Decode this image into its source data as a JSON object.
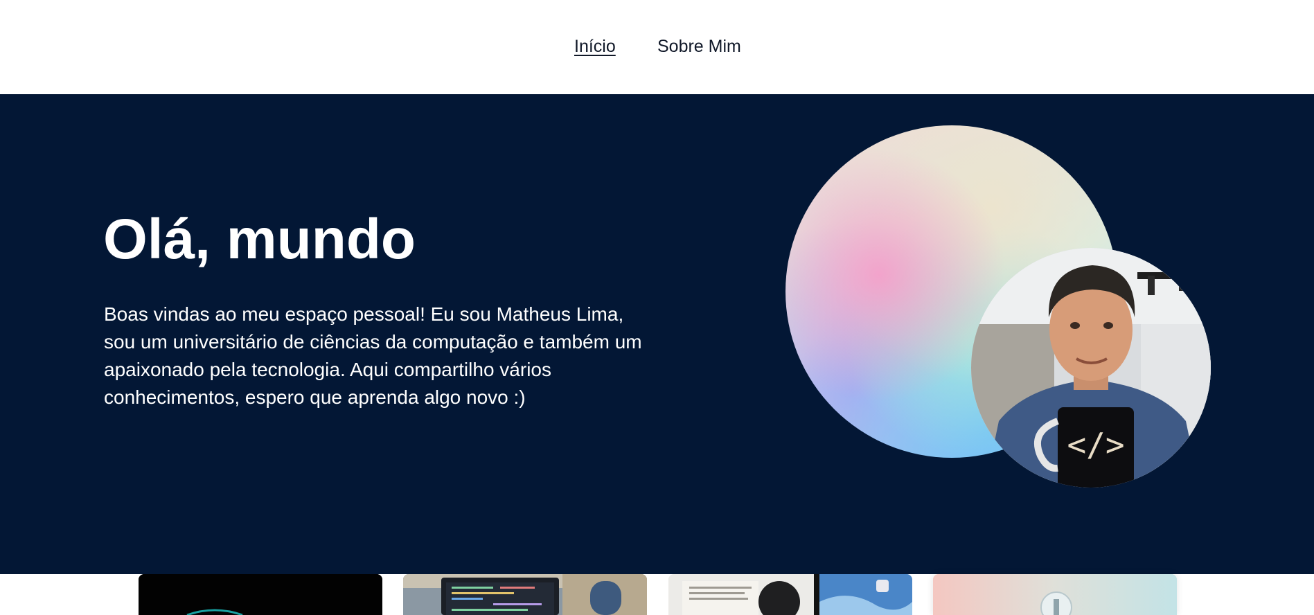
{
  "nav": {
    "home_label": "Início",
    "about_label": "Sobre Mim"
  },
  "hero": {
    "title": "Olá, mundo",
    "text": "Boas vindas ao meu espaço pessoal! Eu sou Matheus Lima, sou um universitário de ciências da computação e também um apaixonado pela tecnologia. Aqui compartilho vários conhecimentos, espero que aprenda algo novo :)"
  },
  "colors": {
    "hero_background": "#031735",
    "nav_text": "#101828",
    "hero_text": "#ffffff"
  },
  "cards": [
    {
      "image": "dark-tech-thumbnail"
    },
    {
      "image": "laptop-code-thumbnail"
    },
    {
      "image": "desk-books-camera-thumbnail"
    },
    {
      "image": "pastel-lightbulb-thumbnail"
    }
  ]
}
